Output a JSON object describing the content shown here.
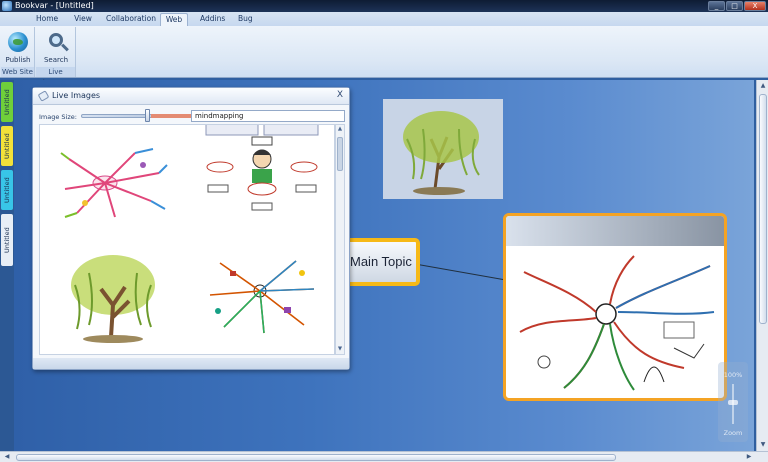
{
  "window": {
    "title": "Bookvar - [Untitled]",
    "minimize": "_",
    "maximize": "□",
    "close": "X"
  },
  "tabs": [
    {
      "label": "Home"
    },
    {
      "label": "View"
    },
    {
      "label": "Collaboration"
    },
    {
      "label": "Web",
      "active": true
    },
    {
      "label": "Addins"
    },
    {
      "label": "Bug"
    }
  ],
  "ribbon": {
    "groups": [
      {
        "label": "Web Site",
        "buttons": [
          {
            "label": "Publish",
            "icon": "globe-icon"
          }
        ]
      },
      {
        "label": "Live Images",
        "buttons": [
          {
            "label": "Search",
            "icon": "search-icon"
          }
        ]
      }
    ]
  },
  "doc_tabs": [
    {
      "label": "Untitled",
      "color": "#6fcf3a"
    },
    {
      "label": "Untitled",
      "color": "#f2e23a"
    },
    {
      "label": "Untitled",
      "color": "#38c5e8"
    },
    {
      "label": "Untitled",
      "color": "#e8eef6"
    }
  ],
  "map": {
    "main_topic": "Main Topic"
  },
  "zoom": {
    "value": "100%",
    "label": "Zoom"
  },
  "live_images": {
    "title": "Live Images",
    "close": "X",
    "size_label": "Image Size:",
    "image_size": 0.6,
    "search_value": "mindmapping"
  },
  "colors": {
    "accent": "#f6b917",
    "workspace": "#3e73bd"
  }
}
